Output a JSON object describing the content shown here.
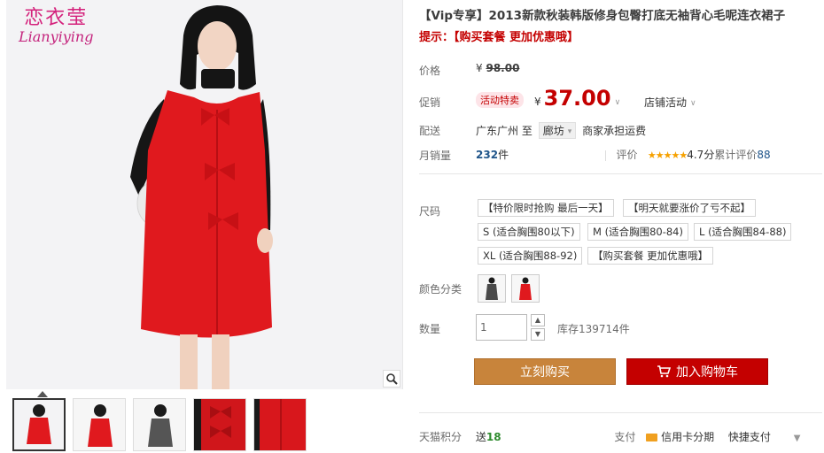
{
  "brand": {
    "cn": "恋衣莹",
    "en": "Lianyiying"
  },
  "title": "【Vip专享】2013新款秋装韩版修身包臀打底无袖背心毛呢连衣裙子",
  "tip": "提示：【购买套餐 更加优惠哦】",
  "price": {
    "label": "价格",
    "currency": "¥",
    "value": "98.00"
  },
  "promo": {
    "label": "促销",
    "badge": "活动特卖",
    "currency": "¥",
    "value": "37.00",
    "shop_activity": "店铺活动"
  },
  "delivery": {
    "label": "配送",
    "from": "广东广州",
    "to_word": "至",
    "city": "廊坊",
    "fee": "商家承担运费"
  },
  "sales": {
    "label": "月销量",
    "count": "232",
    "unit": "件"
  },
  "rating": {
    "label": "评价",
    "score": "4.7分",
    "review_text": "累计评价",
    "review_count": "88"
  },
  "size": {
    "label": "尺码",
    "options": [
      "【特价限时抢购 最后一天】",
      "【明天就要涨价了亏不起】",
      "S (适合胸围80以下)",
      "M (适合胸围80-84)",
      "L (适合胸围84-88)",
      "XL (适合胸围88-92)",
      "【购买套餐 更加优惠哦】"
    ]
  },
  "color": {
    "label": "颜色分类"
  },
  "quantity": {
    "label": "数量",
    "value": "1",
    "stock": "库存139714件"
  },
  "buttons": {
    "buy_now": "立刻购买",
    "add_cart": "加入购物车"
  },
  "bottom": {
    "points_label": "天猫积分",
    "points_prefix": "送",
    "points_value": "18",
    "pay_label": "支付",
    "credit": "信用卡分期",
    "quick": "快捷支付"
  },
  "colors": {
    "accent": "#c40000",
    "buy": "#c8843b",
    "dress": "#e0191e"
  }
}
